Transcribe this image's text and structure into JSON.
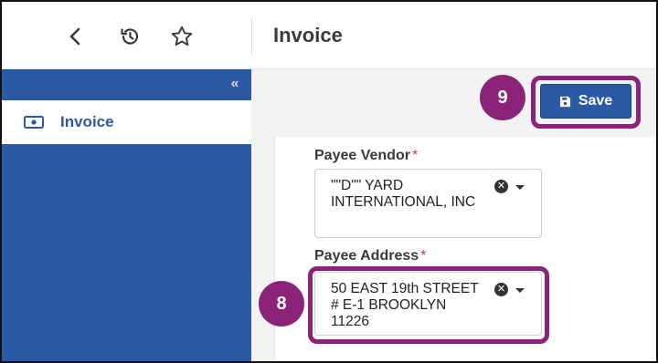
{
  "header": {
    "title": "Invoice",
    "back_icon": "chevron-left-icon",
    "history_icon": "history-icon",
    "favorite_icon": "star-icon"
  },
  "sidebar": {
    "collapse_glyph": "«",
    "items": [
      {
        "label": "Invoice",
        "icon": "money-icon"
      }
    ]
  },
  "toolbar": {
    "save_label": "Save",
    "save_icon": "save-disk-icon"
  },
  "form": {
    "payee_vendor": {
      "label": "Payee Vendor",
      "required_mark": "*",
      "value": "\"\"D\"\" YARD INTERNATIONAL, INC"
    },
    "payee_address": {
      "label": "Payee Address",
      "required_mark": "*",
      "value": "50 EAST 19th STREET # E-1 BROOKLYN 11226"
    }
  },
  "callouts": [
    {
      "number": "9",
      "target": "save-button"
    },
    {
      "number": "8",
      "target": "payee-address-select"
    }
  ],
  "colors": {
    "brand_blue": "#2b59a4",
    "callout_purple": "#8b2479",
    "required_red": "#d9383a"
  }
}
